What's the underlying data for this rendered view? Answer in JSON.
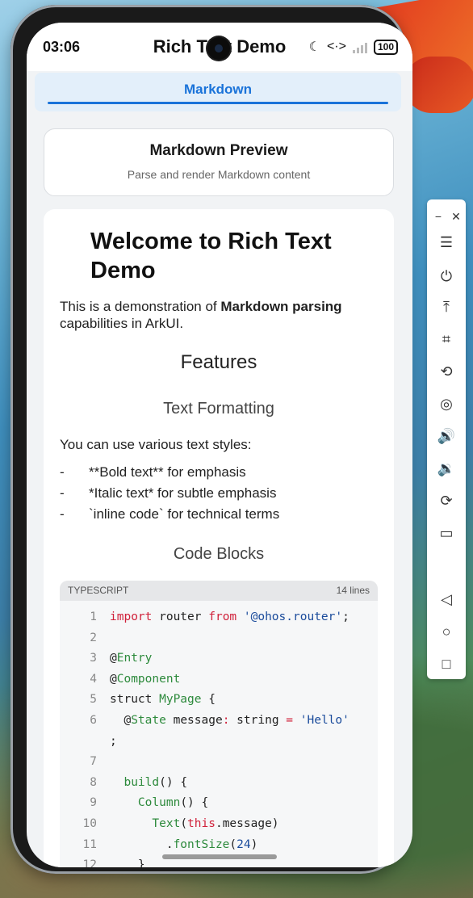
{
  "status": {
    "time": "03:06",
    "battery": "100",
    "moon": "☾",
    "code_glyph": "<·>"
  },
  "app": {
    "title": "Rich Text Demo"
  },
  "tabs": [
    {
      "label": "Markdown"
    }
  ],
  "header_card": {
    "title": "Markdown Preview",
    "subtitle": "Parse and render Markdown content"
  },
  "doc": {
    "h1": "Welcome to Rich Text Demo",
    "intro_pre": "This is a demonstration of ",
    "intro_bold": "Markdown parsing",
    "intro_post": " capabilities in ArkUI.",
    "h2_features": "Features",
    "h3_text": "Text Formatting",
    "p_styles": "You can use various text styles:",
    "bullets": [
      {
        "dash": "-",
        "text": "**Bold text** for emphasis"
      },
      {
        "dash": "-",
        "text": "*Italic text* for subtle emphasis"
      },
      {
        "dash": "-",
        "text": "`inline code` for technical terms"
      }
    ],
    "h3_code": "Code Blocks"
  },
  "code_block": {
    "language": "TYPESCRIPT",
    "lines_count": "14 lines",
    "lines": [
      {
        "n": "1",
        "parts": [
          [
            "kw",
            "import"
          ],
          [
            "txt",
            " router "
          ],
          [
            "kw",
            "from"
          ],
          [
            "txt",
            " "
          ],
          [
            "str",
            "'@ohos.router'"
          ],
          [
            "txt",
            ";"
          ]
        ]
      },
      {
        "n": "2",
        "parts": []
      },
      {
        "n": "3",
        "parts": [
          [
            "txt",
            "@"
          ],
          [
            "ann",
            "Entry"
          ]
        ]
      },
      {
        "n": "4",
        "parts": [
          [
            "txt",
            "@"
          ],
          [
            "ann",
            "Component"
          ]
        ]
      },
      {
        "n": "5",
        "parts": [
          [
            "txt",
            "struct "
          ],
          [
            "fn",
            "MyPage"
          ],
          [
            "txt",
            " {"
          ]
        ]
      },
      {
        "n": "6",
        "parts": [
          [
            "txt",
            "  @"
          ],
          [
            "ann",
            "State"
          ],
          [
            "txt",
            " message"
          ],
          [
            "kw",
            ":"
          ],
          [
            "txt",
            " string "
          ],
          [
            "kw",
            "="
          ],
          [
            "txt",
            " "
          ],
          [
            "str",
            "'Hello'"
          ]
        ]
      },
      {
        "n": "",
        "parts": [
          [
            "txt",
            ";"
          ]
        ]
      },
      {
        "n": "7",
        "parts": []
      },
      {
        "n": "8",
        "parts": [
          [
            "txt",
            "  "
          ],
          [
            "fn",
            "build"
          ],
          [
            "txt",
            "() {"
          ]
        ]
      },
      {
        "n": "9",
        "parts": [
          [
            "txt",
            "    "
          ],
          [
            "fn",
            "Column"
          ],
          [
            "txt",
            "() {"
          ]
        ]
      },
      {
        "n": "10",
        "parts": [
          [
            "txt",
            "      "
          ],
          [
            "fn",
            "Text"
          ],
          [
            "txt",
            "("
          ],
          [
            "kw",
            "this"
          ],
          [
            "txt",
            ".message)"
          ]
        ]
      },
      {
        "n": "11",
        "parts": [
          [
            "txt",
            "        ."
          ],
          [
            "fn",
            "fontSize"
          ],
          [
            "txt",
            "("
          ],
          [
            "num",
            "24"
          ],
          [
            "txt",
            ")"
          ]
        ]
      },
      {
        "n": "12",
        "parts": [
          [
            "txt",
            "    }"
          ]
        ]
      }
    ]
  },
  "panel": {
    "buttons": [
      {
        "name": "minimize-icon",
        "glyph": "−"
      },
      {
        "name": "close-icon",
        "glyph": "✕"
      },
      {
        "name": "menu-icon",
        "glyph": "☰"
      },
      {
        "name": "power-icon",
        "glyph": "⏻"
      },
      {
        "name": "upload-icon",
        "glyph": "⤒"
      },
      {
        "name": "crop-icon",
        "glyph": "⌗"
      },
      {
        "name": "rotate-icon",
        "glyph": "⟲"
      },
      {
        "name": "location-icon",
        "glyph": "◎"
      },
      {
        "name": "volume-up-icon",
        "glyph": "🔊"
      },
      {
        "name": "volume-down-icon",
        "glyph": "🔉"
      },
      {
        "name": "rotate-device-icon",
        "glyph": "⟳"
      },
      {
        "name": "screen-icon",
        "glyph": "▭"
      },
      {
        "name": "back-icon",
        "glyph": "◁"
      },
      {
        "name": "home-icon",
        "glyph": "○"
      },
      {
        "name": "recents-icon",
        "glyph": "□"
      }
    ]
  },
  "colors": {
    "accent": "#1a73d9",
    "keyword": "#d0213a",
    "string": "#1a4b9b",
    "annotation": "#2d8a3c"
  }
}
